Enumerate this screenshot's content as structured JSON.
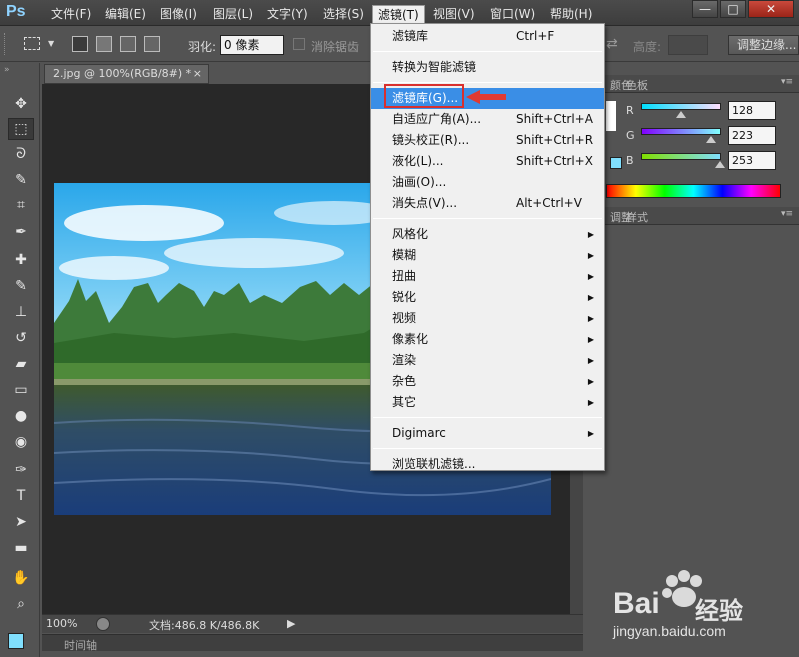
{
  "app": {
    "logo": "Ps"
  },
  "menubar": {
    "items": [
      "文件(F)",
      "编辑(E)",
      "图像(I)",
      "图层(L)",
      "文字(Y)",
      "选择(S)",
      "滤镜(T)",
      "视图(V)",
      "窗口(W)",
      "帮助(H)"
    ],
    "active_index": 6,
    "window_controls": {
      "minimize": "—",
      "restore": "□",
      "close": "✕"
    }
  },
  "options": {
    "feather_label": "羽化:",
    "feather_value": "0 像素",
    "antialias_label": "消除锯齿",
    "height_label": "高度:",
    "refine_button": "调整边缘..."
  },
  "document": {
    "tab_title": "2.jpg @ 100%(RGB/8#) *",
    "tab_close": "×",
    "zoom": "100%",
    "doc_info": "文档:486.8 K/486.8K",
    "status_arrow": "▶"
  },
  "timeline": {
    "label": "时间轴"
  },
  "panels": {
    "color_tabs": [
      "颜色",
      "色板"
    ],
    "channels": [
      {
        "label": "R",
        "value": "128"
      },
      {
        "label": "G",
        "value": "223"
      },
      {
        "label": "B",
        "value": "253"
      }
    ],
    "adj_tabs": [
      "调整",
      "样式"
    ],
    "colors": {
      "foreground": "#80dffd",
      "r_slider": "#80dffd",
      "g_slider": "#80dffd",
      "b_slider": "#80dffd"
    }
  },
  "filter_menu": {
    "items": [
      {
        "label": "滤镜库",
        "shortcut": "Ctrl+F",
        "submenu": false
      },
      {
        "sep": true
      },
      {
        "label": "转换为智能滤镜",
        "shortcut": "",
        "submenu": false
      },
      {
        "sep": true
      },
      {
        "label": "滤镜库(G)...",
        "shortcut": "",
        "submenu": false,
        "highlight": true
      },
      {
        "label": "自适应广角(A)...",
        "shortcut": "Shift+Ctrl+A",
        "submenu": false
      },
      {
        "label": "镜头校正(R)...",
        "shortcut": "Shift+Ctrl+R",
        "submenu": false
      },
      {
        "label": "液化(L)...",
        "shortcut": "Shift+Ctrl+X",
        "submenu": false
      },
      {
        "label": "油画(O)...",
        "shortcut": "",
        "submenu": false
      },
      {
        "label": "消失点(V)...",
        "shortcut": "Alt+Ctrl+V",
        "submenu": false
      },
      {
        "sep": true
      },
      {
        "label": "风格化",
        "shortcut": "",
        "submenu": true
      },
      {
        "label": "模糊",
        "shortcut": "",
        "submenu": true
      },
      {
        "label": "扭曲",
        "shortcut": "",
        "submenu": true
      },
      {
        "label": "锐化",
        "shortcut": "",
        "submenu": true
      },
      {
        "label": "视频",
        "shortcut": "",
        "submenu": true
      },
      {
        "label": "像素化",
        "shortcut": "",
        "submenu": true
      },
      {
        "label": "渲染",
        "shortcut": "",
        "submenu": true
      },
      {
        "label": "杂色",
        "shortcut": "",
        "submenu": true
      },
      {
        "label": "其它",
        "shortcut": "",
        "submenu": true
      },
      {
        "sep": true
      },
      {
        "label": "Digimarc",
        "shortcut": "",
        "submenu": true
      },
      {
        "sep": true
      },
      {
        "label": "浏览联机滤镜...",
        "shortcut": "",
        "submenu": false
      }
    ]
  },
  "watermark": {
    "brand": "Bai",
    "brand2": "经验",
    "url": "jingyan.baidu.com"
  },
  "tools": [
    "move-tool",
    "marquee-tool",
    "lasso-tool",
    "quick-select-tool",
    "crop-tool",
    "eyedropper-tool",
    "healing-tool",
    "brush-tool",
    "stamp-tool",
    "history-brush-tool",
    "eraser-tool",
    "gradient-tool",
    "blur-tool",
    "dodge-tool",
    "pen-tool",
    "type-tool",
    "path-select-tool",
    "shape-tool",
    "hand-tool",
    "zoom-tool"
  ]
}
